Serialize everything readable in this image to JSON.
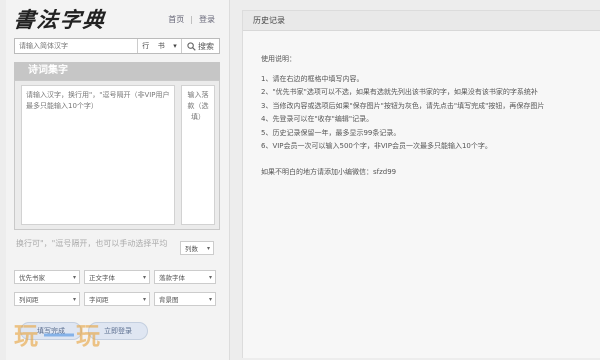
{
  "header": {
    "logo_text": "書法字典",
    "links": [
      "首页",
      "登录"
    ]
  },
  "search": {
    "placeholder": "请输入简体汉字",
    "style_value": "行书",
    "style_chars": [
      "行",
      "书"
    ],
    "button_label": "搜索"
  },
  "poem": {
    "section_title": "诗词集字",
    "main_placeholder": "请输入汉字，换行用\"，\"逗号隔开（非VIP用户最多只能输入10个字）",
    "inscription_placeholder": "输入落款（选填）",
    "hint": "换行可\"，\"逗号隔开，也可以手动选择平均",
    "selects": {
      "columns": "列数",
      "priority_calligrapher": "优先书家",
      "main_font": "正文字体",
      "inscription_font": "落款字体",
      "column_spacing": "列间距",
      "char_spacing": "字间距",
      "background": "背景图"
    },
    "buttons": {
      "finish": "填写完成",
      "login": "立即登录"
    }
  },
  "history": {
    "title": "历史记录",
    "instructions_title": "使用说明：",
    "instructions": [
      "1、请在右边的框格中填写内容。",
      "2、\"优先书家\"选项可以不选，如果有选就先列出该书家的字，如果没有该书家的字系统补",
      "3、当修改内容或选项后如果\"保存图片\"按钮为灰色，请先点击\"填写完成\"按钮，再保存图片",
      "4、先登录可以在\"收存\"编辑\"记录。",
      "5、历史记录保留一年，最多显示99条记录。",
      "6、VIP会员一次可以输入500个字，非VIP会员一次最多只能输入10个字。"
    ],
    "contact": "如果不明白的地方请添加小编微信：sfzd99"
  },
  "watermark": {
    "text": "玩一玩"
  },
  "colors": {
    "panel_header": "#c6c6c6",
    "button_bg": "#dfe6f2",
    "button_text": "#5a6d8e"
  }
}
